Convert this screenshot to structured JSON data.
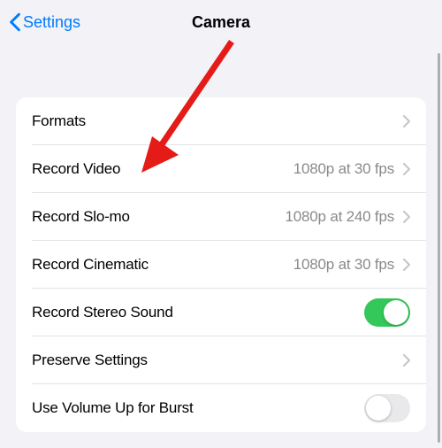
{
  "header": {
    "back_label": "Settings",
    "title": "Camera"
  },
  "rows": {
    "formats": {
      "label": "Formats"
    },
    "record_video": {
      "label": "Record Video",
      "detail": "1080p at 30 fps"
    },
    "record_slomo": {
      "label": "Record Slo-mo",
      "detail": "1080p at 240 fps"
    },
    "record_cinematic": {
      "label": "Record Cinematic",
      "detail": "1080p at 30 fps"
    },
    "stereo_sound": {
      "label": "Record Stereo Sound"
    },
    "preserve": {
      "label": "Preserve Settings"
    },
    "volume_burst": {
      "label": "Use Volume Up for Burst"
    }
  },
  "colors": {
    "accent": "#007aff",
    "toggle_on": "#34c759",
    "arrow": "#e41b17"
  }
}
